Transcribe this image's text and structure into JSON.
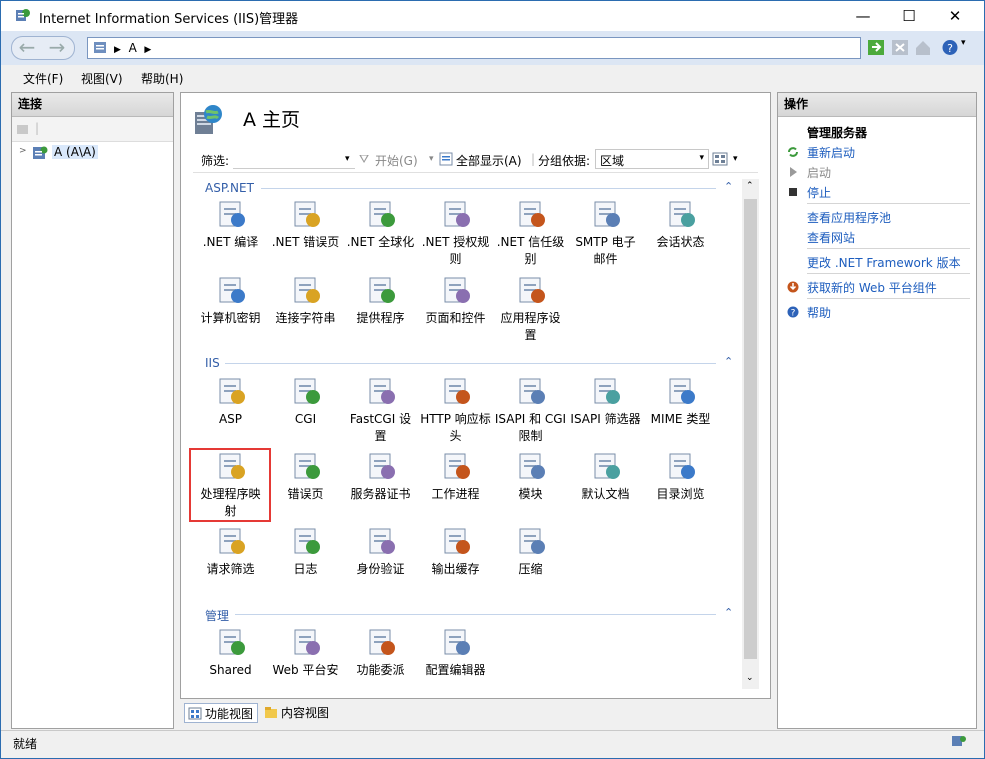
{
  "window": {
    "title": "Internet Information Services (IIS)管理器",
    "minimize": "—",
    "maximize": "☐",
    "close": "✕"
  },
  "address": {
    "path_segment": "A",
    "separator": "▶"
  },
  "menu": [
    "文件(F)",
    "视图(V)",
    "帮助(H)"
  ],
  "connections": {
    "header": "连接",
    "tree_node": "A (A\\A)"
  },
  "feature_page": {
    "title": "A 主页",
    "filter_label": "筛选:",
    "start_button": "开始(G)",
    "show_all_button": "全部显示(A)",
    "group_by_label": "分组依据:",
    "group_by_value": "区域"
  },
  "sections": [
    {
      "name": "ASP.NET",
      "items": [
        ".NET 编译",
        ".NET 错误页",
        ".NET 全球化",
        ".NET 授权规\n则",
        ".NET 信任级\n别",
        "SMTP 电子\n邮件",
        "会话状态",
        "计算机密钥",
        "连接字符串",
        "提供程序",
        "页面和控件",
        "应用程序设\n置"
      ]
    },
    {
      "name": "IIS",
      "items": [
        "ASP",
        "CGI",
        "FastCGI 设\n置",
        "HTTP 响应标\n头",
        "ISAPI 和 CGI\n限制",
        "ISAPI 筛选器",
        "MIME 类型",
        "处理程序映\n射",
        "错误页",
        "服务器证书",
        "工作进程",
        "模块",
        "默认文档",
        "目录浏览",
        "请求筛选",
        "日志",
        "身份验证",
        "输出缓存",
        "压缩"
      ]
    },
    {
      "name": "管理",
      "items": [
        "Shared",
        "Web 平台安",
        "功能委派",
        "配置编辑器"
      ]
    }
  ],
  "view_tabs": {
    "features_view": "功能视图",
    "content_view": "内容视图"
  },
  "actions": {
    "header": "操作",
    "group_title": "管理服务器",
    "items": [
      {
        "label": "重新启动",
        "enabled": true
      },
      {
        "label": "启动",
        "enabled": false
      },
      {
        "label": "停止",
        "enabled": true
      },
      {
        "label": "查看应用程序池",
        "enabled": true
      },
      {
        "label": "查看网站",
        "enabled": true
      },
      {
        "label": "更改 .NET Framework 版本",
        "enabled": true
      },
      {
        "label": "获取新的 Web 平台组件",
        "enabled": true
      },
      {
        "label": "帮助",
        "enabled": true
      }
    ]
  },
  "status": {
    "text": "就绪"
  },
  "colors": {
    "highlight_box": "#e53935",
    "link": "#1d5dbe",
    "section": "#335ea8"
  }
}
